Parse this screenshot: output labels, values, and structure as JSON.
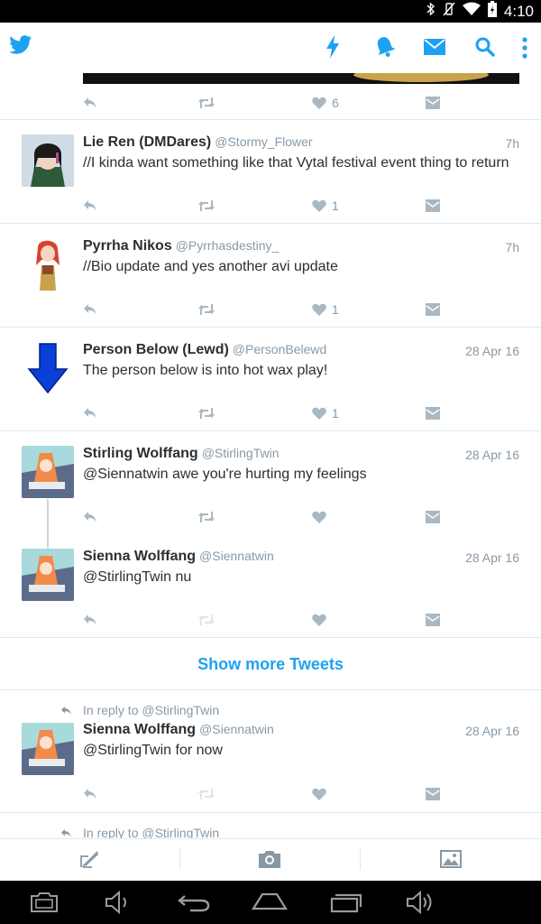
{
  "status_bar": {
    "time": "4:10"
  },
  "app_bar": {
    "icons": [
      "twitter-bird-icon",
      "lightning-icon",
      "bell-icon",
      "envelope-icon",
      "search-icon",
      "overflow-menu-icon"
    ],
    "accent": "#1da1f2"
  },
  "tweets": [
    {
      "like_count": "6"
    },
    {
      "name": "Lie Ren (DMDares)",
      "handle": "@Stormy_Flower",
      "time": "7h",
      "text": "//I kinda want something like that Vytal festival event thing to return",
      "like_count": "1"
    },
    {
      "name": "Pyrrha Nikos",
      "handle": "@Pyrrhasdestiny_",
      "time": "7h",
      "text": "//Bio update and yes another avi update",
      "like_count": "1"
    },
    {
      "name": "Person Below (Lewd)",
      "handle": "@PersonBelewd",
      "time": "28 Apr 16",
      "text": "The person below is into hot wax play!",
      "like_count": "1"
    },
    {
      "name": "Stirling Wolffang",
      "handle": "@StirlingTwin",
      "time": "28 Apr 16",
      "text": "@Siennatwin awe you're hurting my feelings",
      "like_count": ""
    },
    {
      "name": "Sienna Wolffang",
      "handle": "@Siennatwin",
      "time": "28 Apr 16",
      "text": "@StirlingTwin nu",
      "like_count": ""
    },
    {
      "in_reply_to": "In reply to @StirlingTwin",
      "name": "Sienna Wolffang",
      "handle": "@Siennatwin",
      "time": "28 Apr 16",
      "text": "@StirlingTwin for now",
      "like_count": ""
    },
    {
      "in_reply_to": "In reply to @StirlingTwin"
    }
  ],
  "show_more": "Show more Tweets",
  "bottom_bar": {
    "icons": [
      "compose-icon",
      "camera-icon",
      "image-icon"
    ]
  },
  "nav_bar": {
    "icons": [
      "screenshot-icon",
      "volume-down-icon",
      "back-icon",
      "home-icon",
      "recents-icon",
      "volume-up-icon"
    ]
  }
}
